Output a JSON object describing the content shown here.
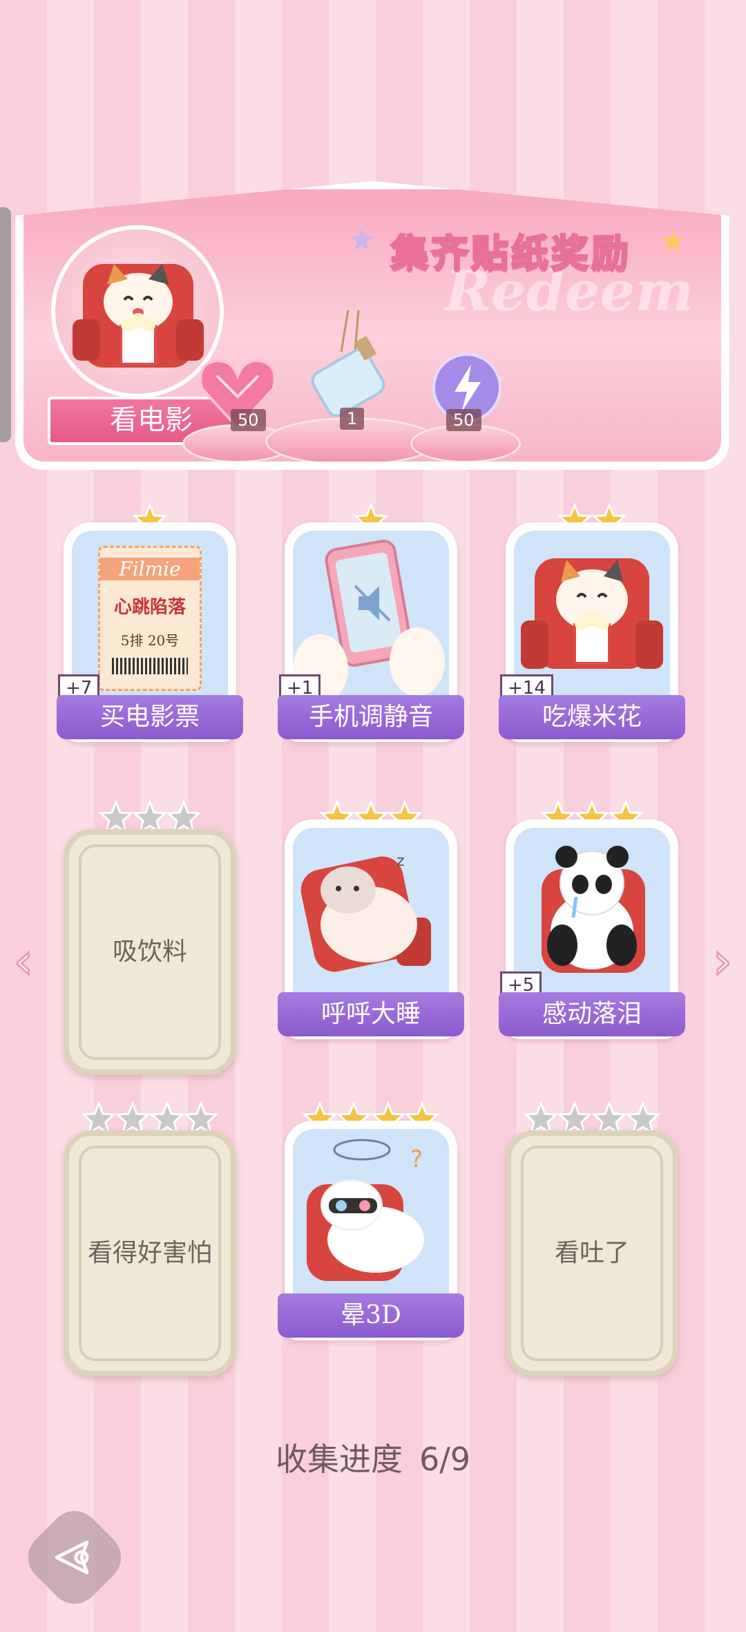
{
  "banner": {
    "title": "集齐贴纸奖励",
    "watermark": "Redeem",
    "theme_label": "看电影",
    "rewards": [
      {
        "icon": "pink-heart-gem-icon",
        "count": "50"
      },
      {
        "icon": "wish-bottle-icon",
        "count": "1"
      },
      {
        "icon": "lightning-orb-icon",
        "count": "50"
      }
    ]
  },
  "cards": [
    {
      "label": "买电影票",
      "stars": 1,
      "unlocked": true,
      "bonus": "+7"
    },
    {
      "label": "手机调静音",
      "stars": 1,
      "unlocked": true,
      "bonus": "+1"
    },
    {
      "label": "吃爆米花",
      "stars": 2,
      "unlocked": true,
      "bonus": "+14"
    },
    {
      "label": "吸饮料",
      "stars": 3,
      "unlocked": false,
      "bonus": ""
    },
    {
      "label": "呼呼大睡",
      "stars": 3,
      "unlocked": true,
      "bonus": ""
    },
    {
      "label": "感动落泪",
      "stars": 3,
      "unlocked": true,
      "bonus": "+5"
    },
    {
      "label": "看得好害怕",
      "stars": 4,
      "unlocked": false,
      "bonus": ""
    },
    {
      "label": "晕3D",
      "stars": 4,
      "unlocked": true,
      "bonus": ""
    },
    {
      "label": "看吐了",
      "stars": 4,
      "unlocked": false,
      "bonus": ""
    }
  ],
  "ticket": {
    "brand": "Filmie",
    "title": "心跳陷落",
    "seat": "5排 20号"
  },
  "progress": {
    "label": "收集进度",
    "value": "6/9"
  },
  "colors": {
    "gold_star": "#f5c542",
    "grey_star": "#c9c9c9",
    "label_purple": "#9466d6",
    "accent_pink": "#e55a87"
  }
}
